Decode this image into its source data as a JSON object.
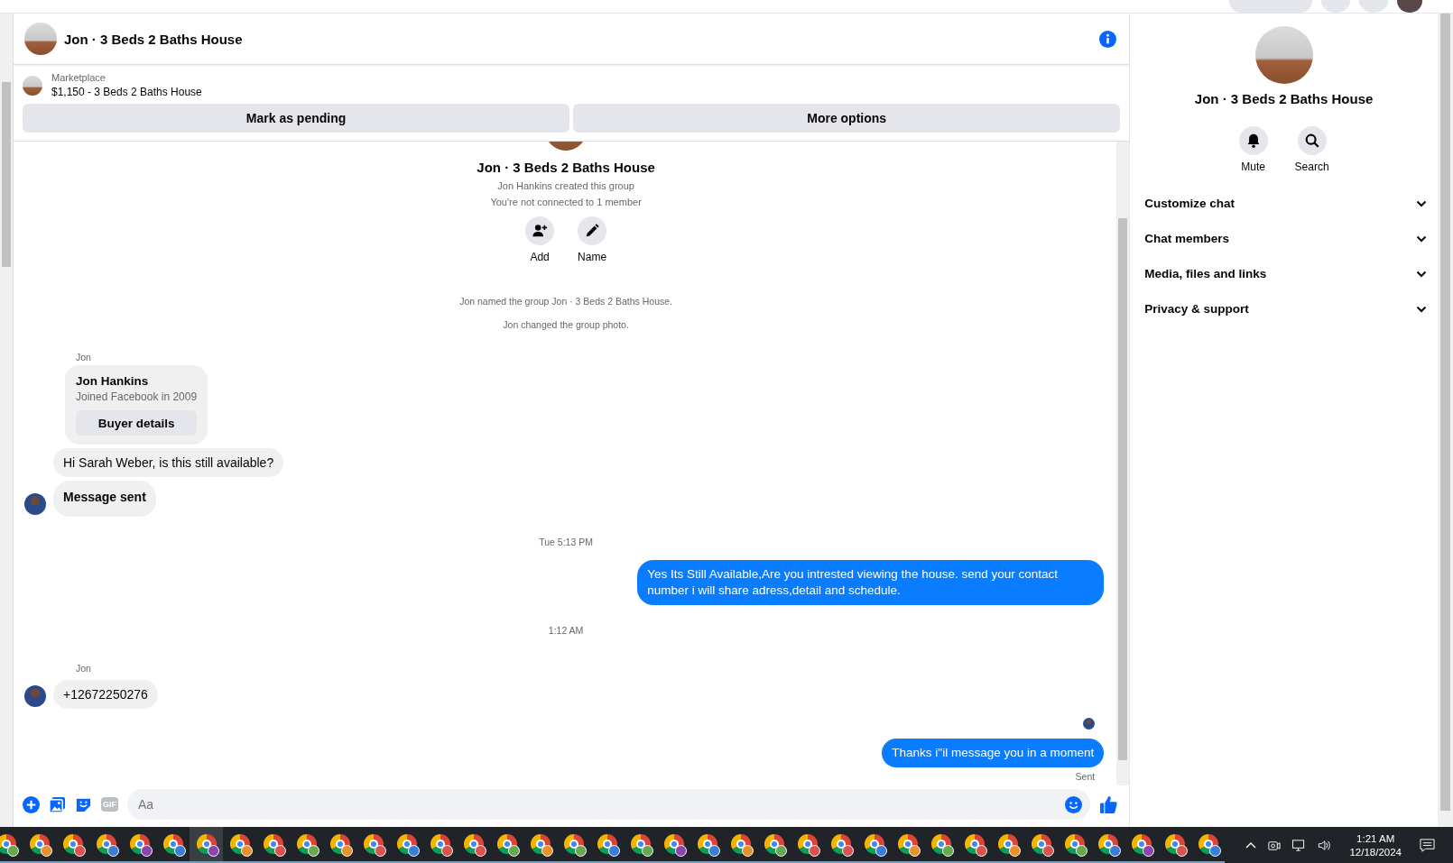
{
  "chat_header": {
    "title": "Jon · 3 Beds 2 Baths House"
  },
  "listing": {
    "source": "Marketplace",
    "title": "$1,150 - 3 Beds 2 Baths House",
    "buttons": [
      "Mark as pending",
      "More options"
    ]
  },
  "messages": [
    {
      "kind": "intro",
      "title": "Jon · 3 Beds 2 Baths House",
      "lines": [
        "Jon Hankins created this group",
        "You're not connected to 1 member"
      ],
      "actions": [
        "Add",
        "Name"
      ]
    },
    {
      "kind": "event",
      "text": "Jon named the group Jon · 3 Beds 2 Baths House."
    },
    {
      "kind": "event",
      "text": "Jon changed the group photo."
    },
    {
      "kind": "sender",
      "text": "Jon"
    },
    {
      "kind": "card",
      "name": "Jon Hankins",
      "subtitle": "Joined Facebook in 2009",
      "button": "Buyer details"
    },
    {
      "kind": "incoming",
      "text": "Hi Sarah Weber, is this still available?",
      "avatar": false,
      "bold": false
    },
    {
      "kind": "incoming",
      "text": "Message sent",
      "avatar": true,
      "bold": true
    },
    {
      "kind": "timestamp",
      "text": "Tue 5:13 PM"
    },
    {
      "kind": "outgoing",
      "text": "Yes Its Still Available,Are you intrested viewing the house. send your contact number i will share adress,detail and schedule."
    },
    {
      "kind": "timestamp",
      "text": "1:12 AM"
    },
    {
      "kind": "sender",
      "text": "Jon"
    },
    {
      "kind": "incoming",
      "text": "+12672250276",
      "avatar": true,
      "bold": false
    },
    {
      "kind": "seen"
    },
    {
      "kind": "outgoing",
      "text": "Thanks i\"il message you in a moment"
    },
    {
      "kind": "status",
      "text": "Sent"
    }
  ],
  "composer": {
    "placeholder": "Aa",
    "gif_label": "GIF"
  },
  "details_panel": {
    "title": "Jon · 3 Beds 2 Baths House",
    "actions": [
      "Mute",
      "Search"
    ],
    "sections": [
      {
        "label": "Customize chat",
        "expanded": false
      },
      {
        "label": "Chat members",
        "expanded": false
      },
      {
        "label": "Media, files and links",
        "expanded": false
      },
      {
        "label": "Privacy & support",
        "expanded": false
      }
    ]
  },
  "taskbar": {
    "apps": [
      {
        "selected": false,
        "color": "#6aa84f"
      },
      {
        "selected": false,
        "color": "#e8912d"
      },
      {
        "selected": false,
        "color": "#d9534f"
      },
      {
        "selected": false,
        "color": "#3b7dd8"
      },
      {
        "selected": false,
        "color": "#8e44ad"
      },
      {
        "selected": false,
        "color": "#3b7dd8"
      },
      {
        "selected": true,
        "color": "#8e44ad"
      },
      {
        "selected": false,
        "color": "#e8912d"
      },
      {
        "selected": false,
        "color": "#d9534f"
      },
      {
        "selected": false,
        "color": "#6aa84f"
      },
      {
        "selected": false,
        "color": "#e8912d"
      },
      {
        "selected": false,
        "color": "#d9534f"
      },
      {
        "selected": false,
        "color": "#3b7dd8"
      },
      {
        "selected": false,
        "color": "#d9534f"
      },
      {
        "selected": false,
        "color": "#d9534f"
      },
      {
        "selected": false,
        "color": "#6aa84f"
      },
      {
        "selected": false,
        "color": "#e8912d"
      },
      {
        "selected": false,
        "color": "#6aa84f"
      },
      {
        "selected": false,
        "color": "#3b7dd8"
      },
      {
        "selected": false,
        "color": "#6aa84f"
      },
      {
        "selected": false,
        "color": "#8e44ad"
      },
      {
        "selected": false,
        "color": "#3b7dd8"
      },
      {
        "selected": false,
        "color": "#e8912d"
      },
      {
        "selected": false,
        "color": "#6aa84f"
      },
      {
        "selected": false,
        "color": "#d9534f"
      },
      {
        "selected": false,
        "color": "#d9534f"
      },
      {
        "selected": false,
        "color": "#3b7dd8"
      },
      {
        "selected": false,
        "color": "#e8912d"
      },
      {
        "selected": false,
        "color": "#6aa84f"
      },
      {
        "selected": false,
        "color": "#d9534f"
      },
      {
        "selected": false,
        "color": "#e8912d"
      },
      {
        "selected": false,
        "color": "#d9534f"
      },
      {
        "selected": false,
        "color": "#6aa84f"
      },
      {
        "selected": false,
        "color": "#3b7dd8"
      },
      {
        "selected": false,
        "color": "#8e44ad"
      },
      {
        "selected": false,
        "color": "#d9534f"
      },
      {
        "selected": false,
        "color": "#3b7dd8"
      }
    ],
    "time": "1:21 AM",
    "date": "12/18/2024"
  }
}
